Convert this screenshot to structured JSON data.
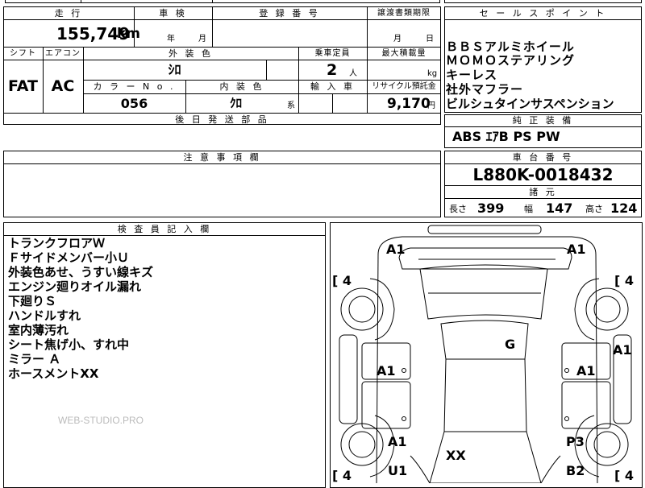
{
  "top_partial": "",
  "headers": {
    "mileage": "走 行",
    "inspection": "車 検",
    "registration": "登 録 番 号",
    "transfer_deadline": "譲渡書類期限",
    "sales_point": "セ ー ル ス ポ イ ン ト",
    "shift": "シフト",
    "aircon": "エアコン",
    "exterior_color": "外 装 色",
    "capacity": "乗車定員",
    "max_load": "最大積載量",
    "color_no": "カ ラ ー N o .",
    "interior_color": "内 装 色",
    "import": "輸 入 車",
    "recycle": "リサイクル預託金",
    "later_parts": "後 日 発 送 部 品",
    "standard_equipment": "純 正 装 備",
    "caution": "注 意 事 項 欄",
    "chassis_no": "車 台 番 号",
    "specs": "諸 元",
    "inspector_notes": "検 査 員 記 入 欄"
  },
  "values": {
    "mileage": "155,749",
    "mileage_unit": "km",
    "inspection_year_unit": "年",
    "inspection_month_unit": "月",
    "transfer_month_unit": "月",
    "transfer_day_unit": "日",
    "shift": "FAT",
    "aircon": "AC",
    "exterior_color": "ｼﾛ",
    "capacity": "2",
    "capacity_unit": "人",
    "max_load_unit": "kg",
    "color_no": "056",
    "interior_color": "ｸﾛ",
    "interior_suffix": "系",
    "recycle_fee": "9,170",
    "recycle_unit": "円"
  },
  "sales_points": [
    "ＢＢＳアルミホイール",
    "ＭＯＭＯステアリング",
    "キーレス",
    "社外マフラー",
    "ビルシュタインサスペンション"
  ],
  "standard_equipment": "ABS ｴｱB PS PW",
  "chassis_number": "L880K-0018432",
  "specs": {
    "length_label": "長さ",
    "length": "399",
    "width_label": "幅",
    "width": "147",
    "height_label": "高さ",
    "height": "124"
  },
  "inspector_notes": [
    "トランクフロアＷ",
    "Ｆサイドメンバー小Ｕ",
    "外装色あせ、うすい線キズ",
    "エンジン廻りオイル漏れ",
    "下廻りＳ",
    "ハンドルすれ",
    "室内薄汚れ",
    "シート焦げ小、すれ中",
    "ミラー Ａ",
    "ホースメントXX"
  ],
  "watermark": "WEB-STUDIO.PRO",
  "diagram": {
    "tires": [
      "[ 4",
      "[ 4",
      "[ 4",
      "[ 4"
    ],
    "marks": [
      "A1",
      "A1",
      "A1",
      "G",
      "A1",
      "A1",
      "A1",
      "P3",
      "XX",
      "U1",
      "B2"
    ]
  }
}
